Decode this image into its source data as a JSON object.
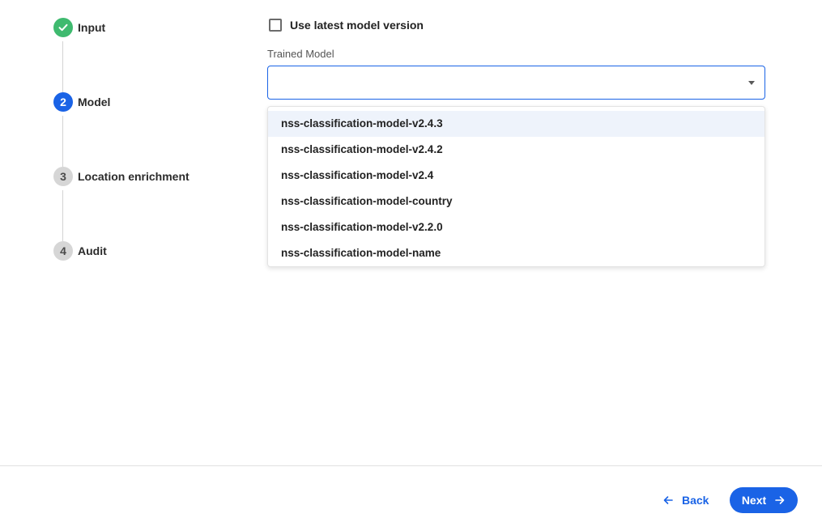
{
  "stepper": {
    "steps": [
      {
        "number": "",
        "label": "Input",
        "state": "done",
        "icon": "check-icon"
      },
      {
        "number": "2",
        "label": "Model",
        "state": "active"
      },
      {
        "number": "3",
        "label": "Location enrichment",
        "state": "todo"
      },
      {
        "number": "4",
        "label": "Audit",
        "state": "todo"
      }
    ]
  },
  "form": {
    "use_latest_label": "Use latest model version",
    "use_latest_checked": false,
    "trained_model_label": "Trained Model",
    "trained_model_value": "",
    "options": [
      "nss-classification-model-v2.4.3",
      "nss-classification-model-v2.4.2",
      "nss-classification-model-v2.4",
      "nss-classification-model-country",
      "nss-classification-model-v2.2.0",
      "nss-classification-model-name"
    ]
  },
  "footer": {
    "back_label": "Back",
    "next_label": "Next"
  },
  "colors": {
    "primary": "#1a63e6",
    "done": "#3fba6f",
    "todo": "#d6d6d6",
    "highlight": "#eef3fb"
  }
}
